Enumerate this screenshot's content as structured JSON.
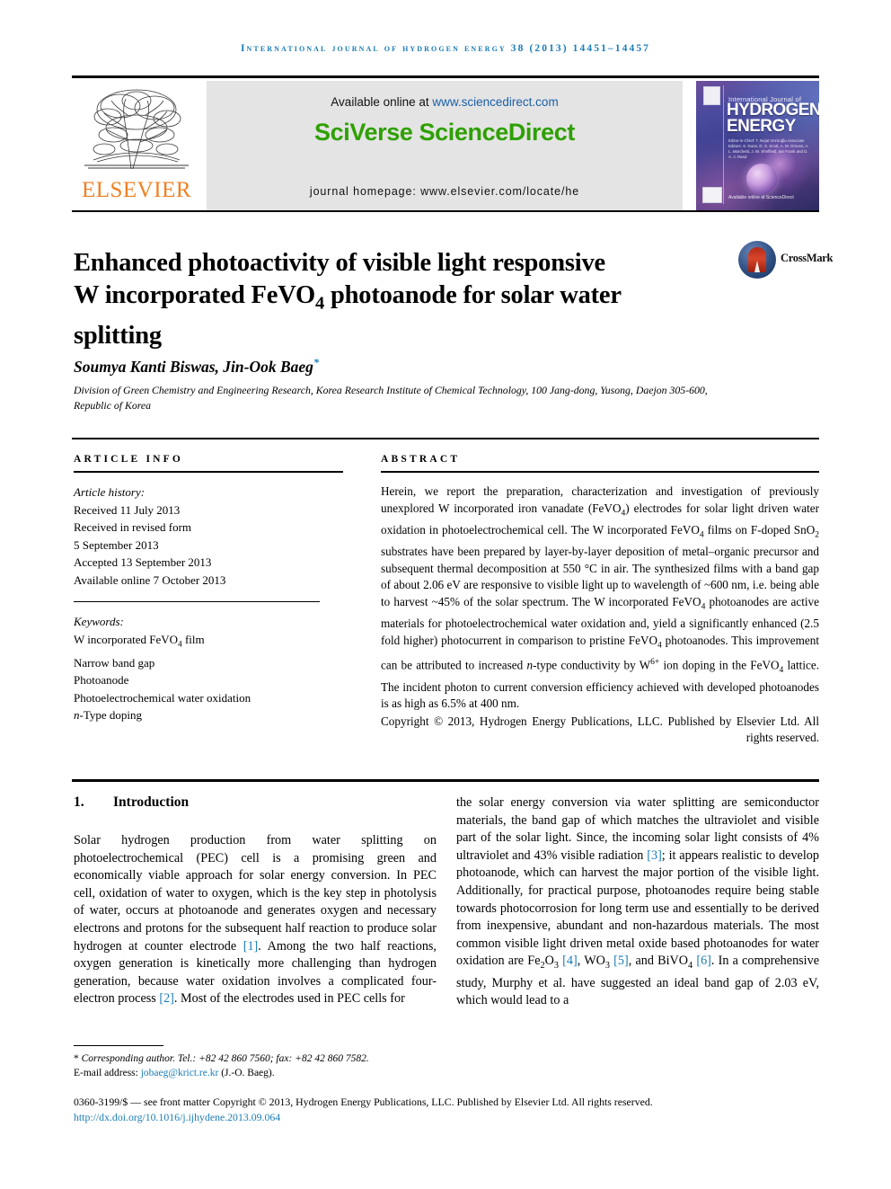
{
  "running_head": "International Journal of Hydrogen Energy 38 (2013) 14451–14457",
  "masthead": {
    "available_text": "Available online at ",
    "available_url": "www.sciencedirect.com",
    "brand": "SciVerse ScienceDirect",
    "homepage": "journal homepage: www.elsevier.com/locate/he",
    "publisher": "ELSEVIER",
    "cover": {
      "line1": "International Journal of",
      "line2": "HYDROGEN",
      "line3": "ENERGY",
      "editors": "Editor-in-Chief: T. Nejat Veziroğlu    Associate Editors: S. Dunn, D. S. Scott, A. M. Groves, A. L. Marchetti, J. W. Sheffield, Ian Frank and D. A. J. Rand",
      "sd_mark": "Available online at ScienceDirect"
    }
  },
  "article": {
    "title_line1": "Enhanced photoactivity of visible light responsive",
    "title_line2_a": "W incorporated FeVO",
    "title_line2_sub": "4",
    "title_line2_b": " photoanode for solar water",
    "title_line3": "splitting",
    "crossmark_label": "CrossMark",
    "authors": "Soumya Kanti Biswas, Jin-Ook Baeg",
    "author_footnote_mark": "*",
    "affiliation": "Division of Green Chemistry and Engineering Research, Korea Research Institute of Chemical Technology, 100 Jang-dong, Yusong, Daejon 305-600, Republic of Korea"
  },
  "article_info": {
    "heading": "ARTICLE INFO",
    "history_label": "Article history:",
    "history": [
      "Received 11 July 2013",
      "Received in revised form",
      "5 September 2013",
      "Accepted 13 September 2013",
      "Available online 7 October 2013"
    ],
    "keywords_label": "Keywords:",
    "keywords": [
      "W incorporated FeVO4 film",
      "Narrow band gap",
      "Photoanode",
      "Photoelectrochemical water oxidation",
      "n-Type doping"
    ]
  },
  "abstract": {
    "heading": "ABSTRACT",
    "text": "Herein, we report the preparation, characterization and investigation of previously unexplored W incorporated iron vanadate (FeVO4) electrodes for solar light driven water oxidation in photoelectrochemical cell. The W incorporated FeVO4 films on F-doped SnO2 substrates have been prepared by layer-by-layer deposition of metal–organic precursor and subsequent thermal decomposition at 550 °C in air. The synthesized films with a band gap of about 2.06 eV are responsive to visible light up to wavelength of ~600 nm, i.e. being able to harvest ~45% of the solar spectrum. The W incorporated FeVO4 photoanodes are active materials for photoelectrochemical water oxidation and, yield a significantly enhanced (2.5 fold higher) photocurrent in comparison to pristine FeVO4 photoanodes. This improvement can be attributed to increased n-type conductivity by W6+ ion doping in the FeVO4 lattice. The incident photon to current conversion efficiency achieved with developed photoanodes is as high as 6.5% at 400 nm.",
    "copyright": "Copyright © 2013, Hydrogen Energy Publications, LLC. Published by Elsevier Ltd. All rights reserved."
  },
  "introduction": {
    "number": "1.",
    "title": "Introduction",
    "left_text": "Solar hydrogen production from water splitting on photoelectrochemical (PEC) cell is a promising green and economically viable approach for solar energy conversion. In PEC cell, oxidation of water to oxygen, which is the key step in photolysis of water, occurs at photoanode and generates oxygen and necessary electrons and protons for the subsequent half reaction to produce solar hydrogen at counter electrode [1]. Among the two half reactions, oxygen generation is kinetically more challenging than hydrogen generation, because water oxidation involves a complicated four-electron process [2]. Most of the electrodes used in PEC cells for",
    "right_text": "the solar energy conversion via water splitting are semiconductor materials, the band gap of which matches the ultraviolet and visible part of the solar light. Since, the incoming solar light consists of 4% ultraviolet and 43% visible radiation [3]; it appears realistic to develop photoanode, which can harvest the major portion of the visible light. Additionally, for practical purpose, photoanodes require being stable towards photocorrosion for long term use and essentially to be derived from inexpensive, abundant and non-hazardous materials. The most common visible light driven metal oxide based photoanodes for water oxidation are Fe2O3 [4], WO3 [5], and BiVO4 [6]. In a comprehensive study, Murphy et al. have suggested an ideal band gap of 2.03 eV, which would lead to a"
  },
  "footer": {
    "corresponding_mark": "*",
    "corresponding": "Corresponding author. Tel.: +82 42 860 7560; fax: +82 42 860 7582.",
    "email_label": "E-mail address: ",
    "email": "jobaeg@krict.re.kr",
    "email_suffix": " (J.-O. Baeg).",
    "issn_line": "0360-3199/$ — see front matter Copyright © 2013, Hydrogen Energy Publications, LLC. Published by Elsevier Ltd. All rights reserved.",
    "doi": "http://dx.doi.org/10.1016/j.ijhydene.2013.09.064"
  },
  "colors": {
    "link": "#1a7db6",
    "sciencedirect_green": "#2ea000",
    "elsevier_orange": "#f08023",
    "sd_url_blue": "#1a5fa8"
  }
}
